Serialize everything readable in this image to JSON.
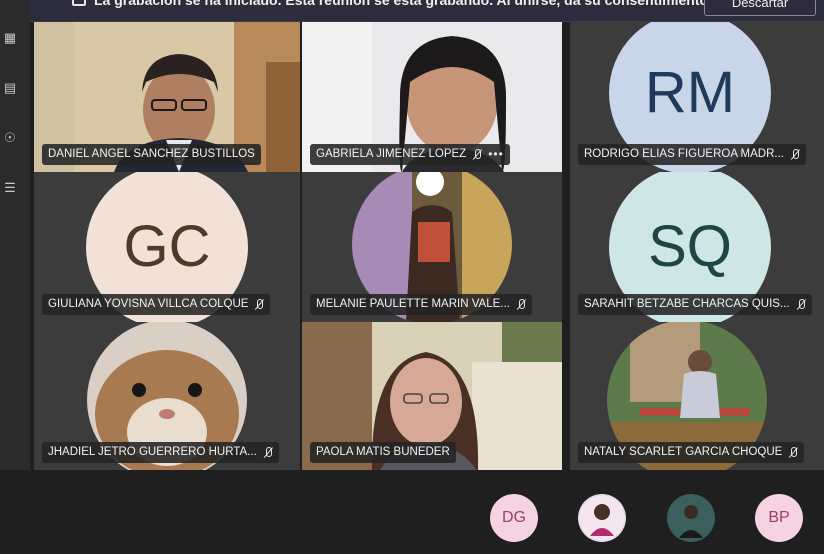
{
  "banner": {
    "text": "La grabación se ha iniciado. Esta reunión se está grabando. Al unirse, da su consentimiento...",
    "button_label": "Descartar"
  },
  "participants": [
    {
      "name": "DANIEL ANGEL SANCHEZ BUSTILLOS",
      "kind": "video",
      "mic": "none"
    },
    {
      "name": "GABRIELA JIMENEZ LOPEZ",
      "kind": "video",
      "mic": "muted",
      "more": "•••"
    },
    {
      "name": "RODRIGO ELIAS FIGUEROA MADR...",
      "kind": "initials",
      "initials": "RM",
      "mic": "muted",
      "avatar_bg": "#c9d6ea",
      "avatar_fg": "#213a5c"
    },
    {
      "name": "GIULIANA YOVISNA VILLCA COLQUE",
      "kind": "initials",
      "initials": "GC",
      "mic": "muted",
      "avatar_bg": "#f1e1d6",
      "avatar_fg": "#4e3a2b"
    },
    {
      "name": "MELANIE PAULETTE MARIN VALE...",
      "kind": "photo",
      "mic": "muted"
    },
    {
      "name": "SARAHIT BETZABE CHARCAS QUIS...",
      "kind": "initials",
      "initials": "SQ",
      "mic": "muted",
      "avatar_bg": "#cfe6e6",
      "avatar_fg": "#1f4646"
    },
    {
      "name": "JHADIEL JETRO GUERRERO HURTA...",
      "kind": "photo",
      "mic": "muted"
    },
    {
      "name": "PAOLA MATIS BUNEDER",
      "kind": "video",
      "mic": "none"
    },
    {
      "name": "NATALY SCARLET GARCIA CHOQUE",
      "kind": "photo",
      "mic": "muted"
    }
  ],
  "bottom_avatars": [
    {
      "initials": "DG",
      "bg": "#f6d3e3",
      "fg": "#9c3e6a"
    },
    {
      "initials": "",
      "kind": "photo"
    },
    {
      "initials": "",
      "kind": "photo"
    },
    {
      "initials": "BP",
      "bg": "#f6d3e3",
      "fg": "#9c3e6a"
    }
  ],
  "rail_icons": [
    "calendar-icon",
    "files-icon",
    "location-icon",
    "list-icon"
  ]
}
